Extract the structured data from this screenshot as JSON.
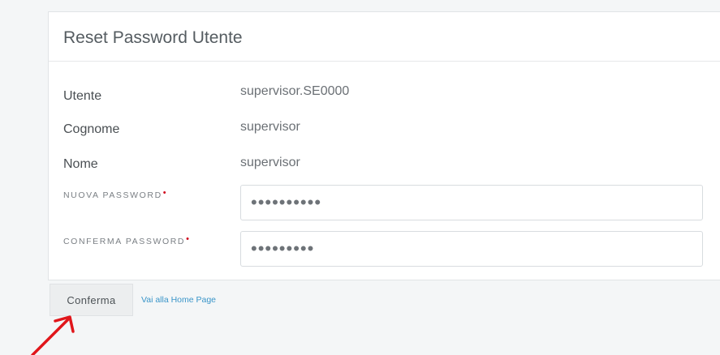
{
  "panel": {
    "title": "Reset Password Utente"
  },
  "info_rows": [
    {
      "label": "Utente",
      "value": "supervisor.SE0000"
    },
    {
      "label": "Cognome",
      "value": "supervisor"
    },
    {
      "label": "Nome",
      "value": "supervisor"
    }
  ],
  "form": {
    "new_password": {
      "label": "NUOVA PASSWORD",
      "required_mark": "•",
      "value": "••••••••••"
    },
    "confirm_password": {
      "label": "CONFERMA PASSWORD",
      "required_mark": "•",
      "value": "•••••••••"
    }
  },
  "actions": {
    "confirm_label": "Conferma",
    "home_link_label": "Vai alla Home Page"
  },
  "colors": {
    "accent_link": "#3a95c9",
    "required": "#d0021b",
    "annotation_arrow": "#e0161b"
  }
}
